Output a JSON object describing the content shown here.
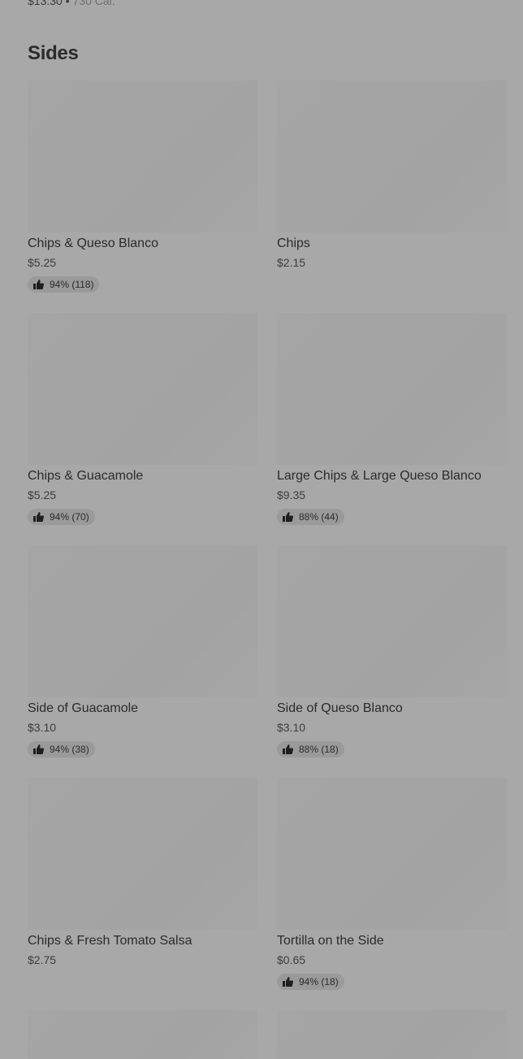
{
  "previous_item": {
    "price": "$13.30",
    "separator": "•",
    "calories": "730 Cal."
  },
  "section": {
    "title": "Sides"
  },
  "items": [
    {
      "name": "Chips & Queso Blanco",
      "price": "$5.25",
      "rating": "94% (118)"
    },
    {
      "name": "Chips",
      "price": "$2.15",
      "rating": ""
    },
    {
      "name": "Chips & Guacamole",
      "price": "$5.25",
      "rating": "94% (70)"
    },
    {
      "name": "Large Chips & Large Queso Blanco",
      "price": "$9.35",
      "rating": "88% (44)"
    },
    {
      "name": "Side of Guacamole",
      "price": "$3.10",
      "rating": "94% (38)"
    },
    {
      "name": "Side of Queso Blanco",
      "price": "$3.10",
      "rating": "88% (18)"
    },
    {
      "name": "Chips & Fresh Tomato Salsa",
      "price": "$2.75",
      "rating": ""
    },
    {
      "name": "Tortilla on the Side",
      "price": "$0.65",
      "rating": "94% (18)"
    }
  ],
  "icons": {
    "rating": "thumbs-up-icon"
  },
  "colors": {
    "overlay_background": "#a8a8a8",
    "image_placeholder": "#a4a4a4",
    "rating_pill": "#9a9a9a",
    "text": "#2b2b2b"
  }
}
